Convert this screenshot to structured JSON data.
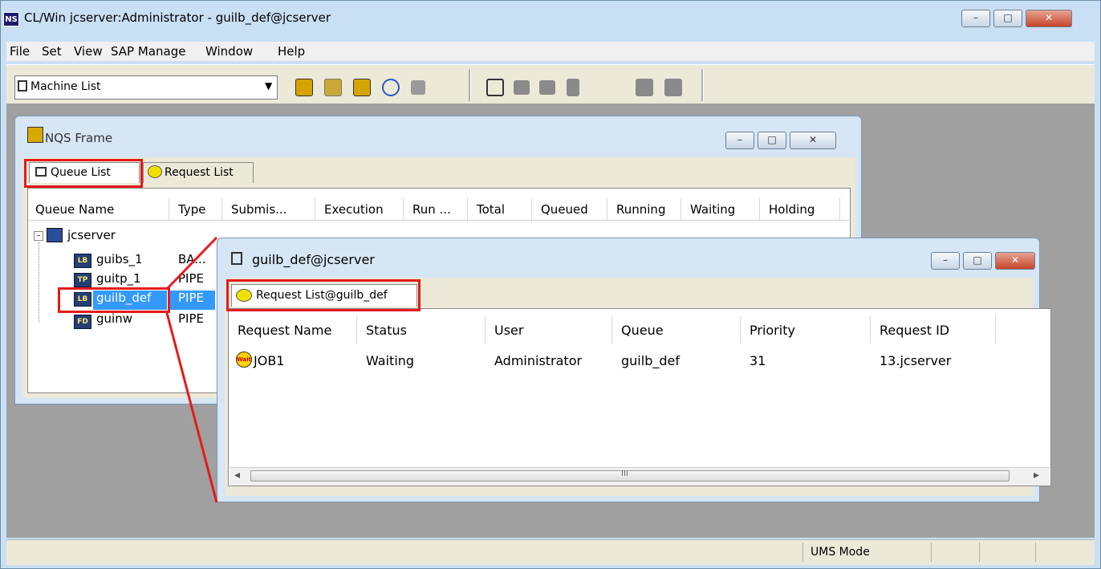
{
  "window": {
    "app_icon": "NS",
    "title": "CL/Win jcserver:Administrator - guilb_def@jcserver",
    "controls": {
      "minimize": "–",
      "maximize": "□",
      "close": "✕"
    }
  },
  "menu": [
    "File",
    "Set",
    "View",
    "SAP Manage",
    "Window",
    "Help"
  ],
  "menu_underline": [
    "F",
    "S",
    "V",
    "M",
    "W",
    "H"
  ],
  "toolbar": {
    "combo_value": "Machine List",
    "combo_arrow": "▼",
    "icons": [
      "queue-icon",
      "key-icon",
      "nqs-icon",
      "refresh-icon",
      "find-icon",
      "help-f1-icon",
      "folder-icon",
      "folder2-icon",
      "doc-icon",
      "machines-icon",
      "machines2-icon"
    ]
  },
  "nqs_frame": {
    "title": "NQS Frame",
    "tabs": [
      "Queue List",
      "Request List"
    ],
    "columns": [
      "Queue Name",
      "Type",
      "Submis...",
      "Execution",
      "Run ...",
      "Total",
      "Queued",
      "Running",
      "Waiting",
      "Holding"
    ],
    "tree_root": "jcserver",
    "tree_expander": "–",
    "queues": [
      {
        "icon_text": "LB",
        "name": "guibs_1",
        "type": "BA..."
      },
      {
        "icon_text": "TP",
        "name": "guitp_1",
        "type": "PIPE"
      },
      {
        "icon_text": "LB",
        "name": "guilb_def",
        "type": "PIPE"
      },
      {
        "icon_text": "FD",
        "name": "guinw",
        "type": "PIPE"
      }
    ]
  },
  "request_window": {
    "title": "guilb_def@jcserver",
    "tab": "Request List@guilb_def",
    "columns": [
      "Request Name",
      "Status",
      "User",
      "Queue",
      "Priority",
      "Request ID"
    ],
    "rows": [
      {
        "icon_text": "Wait",
        "name": "JOB1",
        "status": "Waiting",
        "user": "Administrator",
        "queue": "guilb_def",
        "priority": "31",
        "request_id": "13.jcserver"
      }
    ],
    "scroll_left": "◂",
    "scroll_right": "▸",
    "scroll_grip": "III"
  },
  "status_bar": {
    "mode": "UMS Mode"
  }
}
